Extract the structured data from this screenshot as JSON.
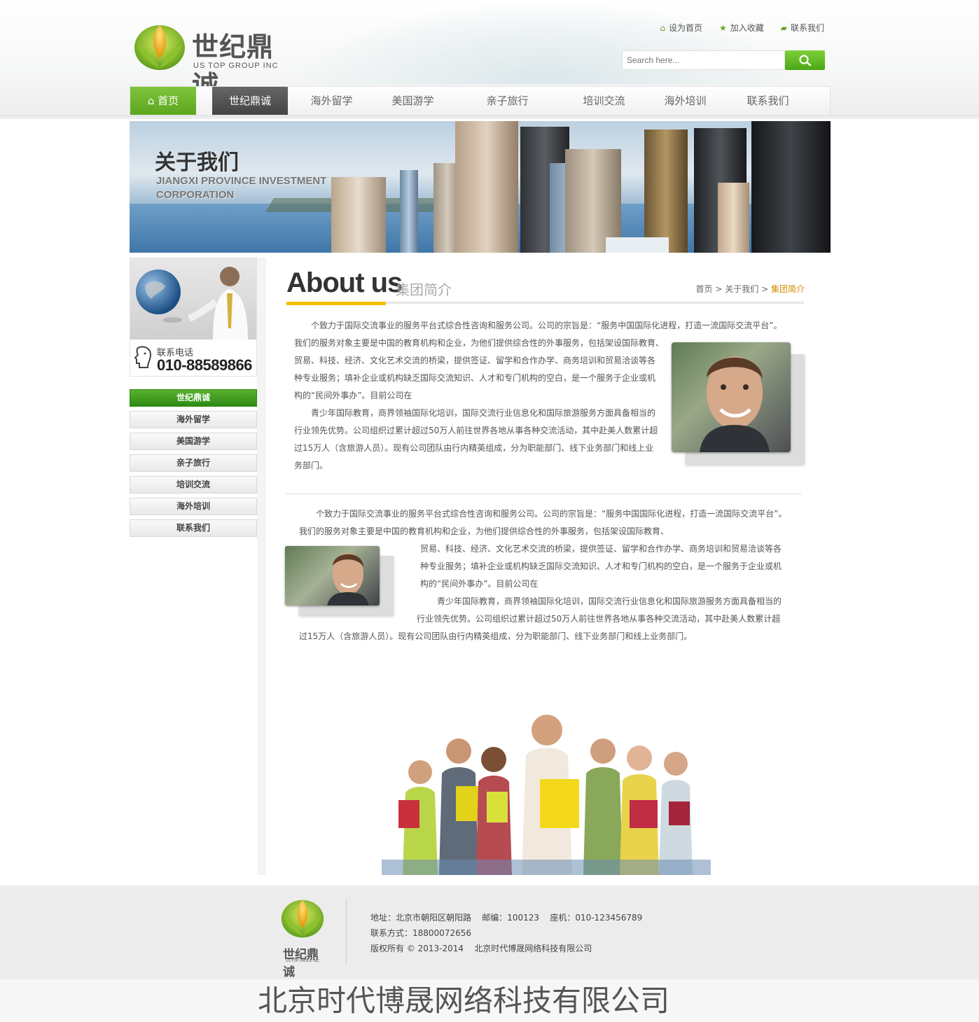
{
  "brand": {
    "name": "世纪鼎诚",
    "sub": "US TOP GROUP INC",
    "color_green": "#6aa52a"
  },
  "toplinks": [
    {
      "label": "设为首页",
      "icon": "home-icon"
    },
    {
      "label": "加入收藏",
      "icon": "star-icon"
    },
    {
      "label": "联系我们",
      "icon": "chat-icon"
    }
  ],
  "search": {
    "placeholder": "Search here..."
  },
  "nav": [
    "首页",
    "世纪鼎诚",
    "海外留学",
    "美国游学",
    "亲子旅行",
    "培训交流",
    "海外培训",
    "联系我们"
  ],
  "banner": {
    "title": "关于我们",
    "en1": "JIANGXI PROVINCE INVESTMENT",
    "en2": "CORPORATION"
  },
  "side": {
    "phone_label": "联系电话",
    "phone": "010-88589866",
    "menu": [
      "世纪鼎诚",
      "海外留学",
      "美国游学",
      "亲子旅行",
      "培训交流",
      "海外培训",
      "联系我们"
    ]
  },
  "content": {
    "title": "About us",
    "subtitle": "集团简介",
    "crumb": [
      "首页",
      "关于我们",
      "集团简介"
    ],
    "p1": [
      "个致力于国际交流事业的服务平台式综合性咨询和服务公司。公司的宗旨是：“服务中国国际化进程，打造一流国际交流平台”。",
      "我们的服务对象主要是中国的教育机构和企业，为他们提供综合性的外事服务，包括架设国际教育、",
      "贸易、科技、经济、文化艺术交流的桥梁，提供签证、留学和合作办学、商务培训和贸易洽谈等各",
      "种专业服务；填补企业或机构缺乏国际交流知识、人才和专门机构的空白，是一个服务于企业或机",
      "构的“民间外事办”。目前公司在",
      "青少年国际教育，商界领袖国际化培训，国际交流行业信息化和国际旅游服务方面具备相当的",
      "行业领先优势。公司组织过累计超过50万人前往世界各地从事各种交流活动，其中赴美人数累计超",
      "过15万人（含旅游人员）。现有公司团队由行内精英组成，分为职能部门、线下业务部门和线上业",
      "务部门。"
    ],
    "p2": [
      "个致力于国际交流事业的服务平台式综合性咨询和服务公司。公司的宗旨是：“服务中国国际化进程，打造一流国际交流平台”。",
      "我们的服务对象主要是中国的教育机构和企业，为他们提供综合性的外事服务，包括架设国际教育、",
      "贸易、科技、经济、文化艺术交流的桥梁，提供签证、留学和合作办学、商务培训和贸易洽谈等各",
      "种专业服务；填补企业或机构缺乏国际交流知识、人才和专门机构的空白，是一个服务于企业或机",
      "构的“民间外事办”。目前公司在",
      "青少年国际教育，商界领袖国际化培训，国际交流行业信息化和国际旅游服务方面具备相当的",
      "行业领先优势。公司组织过累计超过50万人前往世界各地从事各种交流活动，其中赴美人数累计超",
      "过15万人（含旅游人员）。现有公司团队由行内精英组成，分为职能部门、线下业务部门和线上业务部门。"
    ]
  },
  "footer": {
    "logo": "世纪鼎诚",
    "logo_sub": "US TOP GROUP INC",
    "line1": "地址：北京市朝阳区朝阳路    邮编：100123    座机：010-123456789",
    "line2": "联系方式：18800072656",
    "line3": "版权所有 © 2013-2014    北京时代博晟网络科技有限公司"
  },
  "bottom_title": "北京时代博晟网络科技有限公司"
}
